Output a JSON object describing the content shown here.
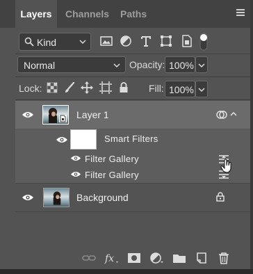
{
  "tabs": [
    {
      "label": "Layers",
      "active": true
    },
    {
      "label": "Channels",
      "active": false
    },
    {
      "label": "Paths",
      "active": false
    }
  ],
  "filter": {
    "kind_label": "Kind",
    "icons": [
      "image-filter-icon",
      "adjustment-filter-icon",
      "type-filter-icon",
      "shape-filter-icon",
      "smart-object-filter-icon",
      "filter-toggle-icon"
    ]
  },
  "blend": {
    "mode": "Normal",
    "opacity_label": "Opacity:",
    "opacity_value": "100%"
  },
  "lock": {
    "label": "Lock:",
    "fill_label": "Fill:",
    "fill_value": "100%"
  },
  "layers": {
    "layer1": {
      "name": "Layer 1",
      "selected": true
    },
    "smart_filters": {
      "name": "Smart Filters"
    },
    "filters": [
      {
        "name": "Filter Gallery"
      },
      {
        "name": "Filter Gallery"
      }
    ],
    "background": {
      "name": "Background"
    }
  },
  "bottom_toolbar": [
    "link-layers-icon",
    "fx-icon",
    "add-mask-icon",
    "adjustment-layer-icon",
    "new-group-icon",
    "new-layer-icon",
    "delete-icon"
  ],
  "colors": {
    "panel": "#535353",
    "tabbar": "#424242",
    "selected_row": "#6b6b6b",
    "sub_row": "#5d5d5d"
  }
}
